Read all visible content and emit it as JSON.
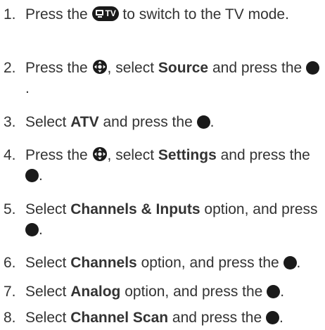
{
  "buttons": {
    "tv_label": "TV"
  },
  "steps": [
    {
      "num": "1.",
      "a": "Press the ",
      "b": " to switch to the TV mode."
    },
    {
      "num": "2.",
      "a": "Press the ",
      "b": ", select ",
      "c": "Source",
      "d": " and press the ",
      "e": "."
    },
    {
      "num": "3.",
      "a": "Select ",
      "b": "ATV",
      "c": " and press the ",
      "d": "."
    },
    {
      "num": "4.",
      "a": "Press the ",
      "b": ", select ",
      "c": "Settings",
      "d": " and press the ",
      "e": "."
    },
    {
      "num": "5.",
      "a": "Select ",
      "b": "Channels & Inputs",
      "c": " option, and press ",
      "d": "."
    },
    {
      "num": "6.",
      "a": "Select ",
      "b": "Channels",
      "c": " option, and press the ",
      "d": "."
    },
    {
      "num": "7.",
      "a": "Select ",
      "b": "Analog",
      "c": " option, and press the ",
      "d": "."
    },
    {
      "num": "8.",
      "a": "Select ",
      "b": "Channel Scan",
      "c": " and press the ",
      "d": "."
    }
  ]
}
